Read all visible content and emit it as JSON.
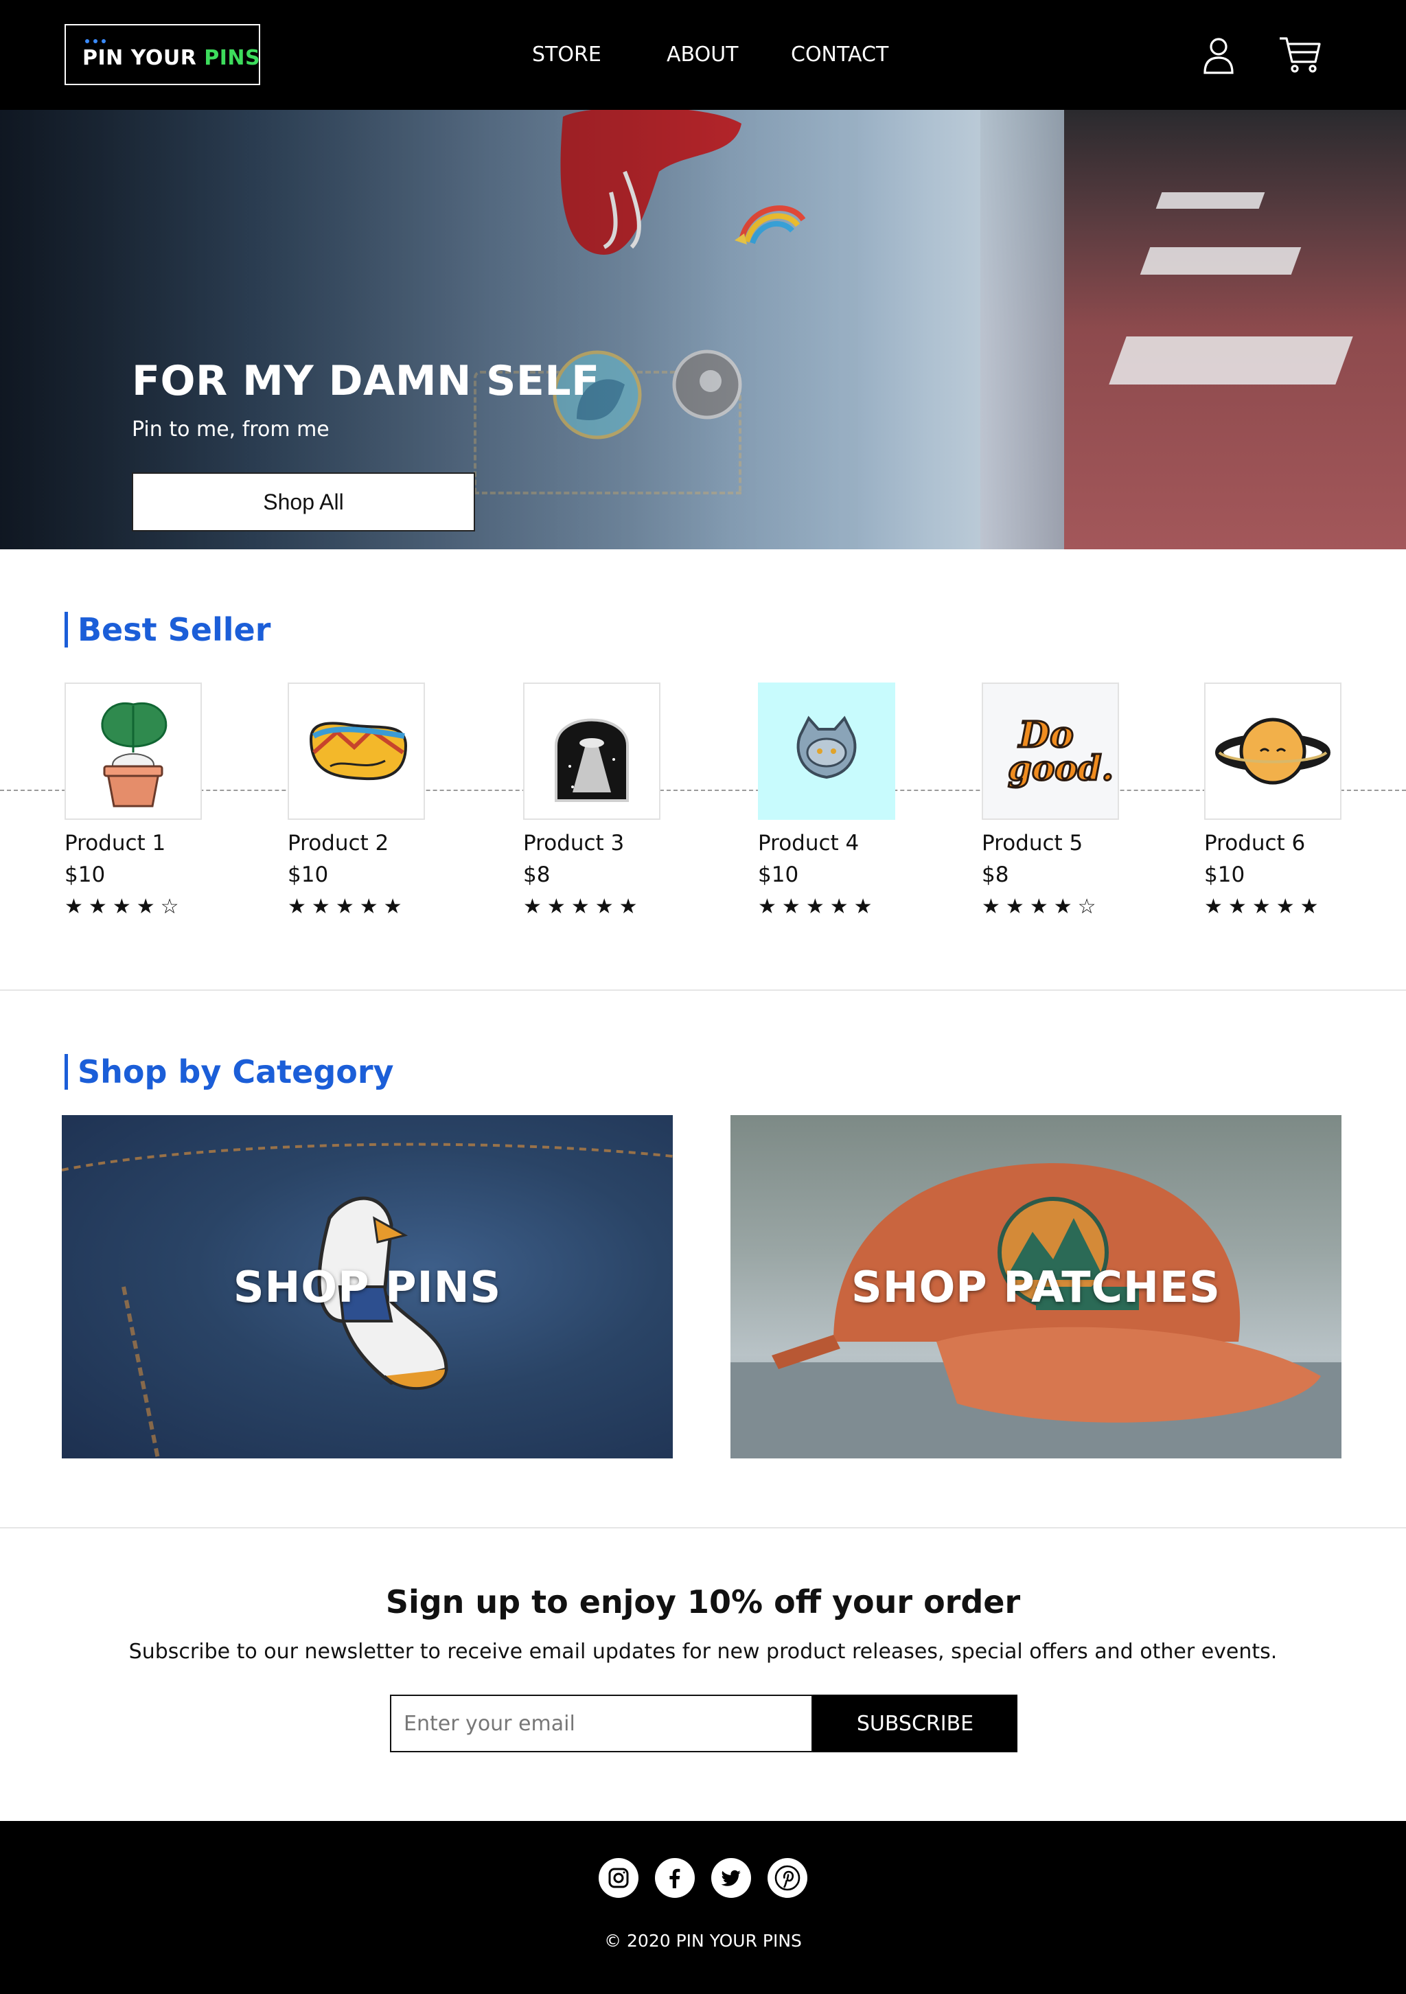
{
  "header": {
    "logo": {
      "part1": "PIN YOUR ",
      "part2": "PINS"
    },
    "nav": [
      "STORE",
      "ABOUT",
      "CONTACT"
    ],
    "icons": [
      "user-icon",
      "cart-icon"
    ]
  },
  "hero": {
    "title": "FOR MY DAMN SELF",
    "subtitle": "Pin to me, from me",
    "button": "Shop All"
  },
  "best_seller": {
    "heading": "Best Seller",
    "products": [
      {
        "name": "Product 1",
        "price": "$10",
        "rating": 4,
        "thumb_bg": "#ffffff"
      },
      {
        "name": "Product 2",
        "price": "$10",
        "rating": 5,
        "thumb_bg": "#ffffff"
      },
      {
        "name": "Product 3",
        "price": "$8",
        "rating": 5,
        "thumb_bg": "#ffffff"
      },
      {
        "name": "Product 4",
        "price": "$10",
        "rating": 5,
        "thumb_bg": "#c8fbfd"
      },
      {
        "name": "Product 5",
        "price": "$8",
        "rating": 4,
        "thumb_bg": "#f6f7f9"
      },
      {
        "name": "Product 6",
        "price": "$10",
        "rating": 5,
        "thumb_bg": "#ffffff"
      }
    ]
  },
  "categories": {
    "heading": "Shop by Category",
    "items": [
      {
        "label": "SHOP PINS"
      },
      {
        "label": "SHOP PATCHES"
      }
    ]
  },
  "newsletter": {
    "title": "Sign up to enjoy 10% off your order",
    "description": "Subscribe to our newsletter to receive email updates for new product releases, special offers and other events.",
    "placeholder": "Enter your email",
    "button": "SUBSCRIBE"
  },
  "footer": {
    "socials": [
      "instagram-icon",
      "facebook-icon",
      "twitter-icon",
      "pinterest-icon"
    ],
    "copyright": "© 2020 PIN YOUR PINS"
  },
  "colors": {
    "accent": "#1b5ed8",
    "logo_green": "#3ddc5c",
    "header_bg": "#000000"
  }
}
